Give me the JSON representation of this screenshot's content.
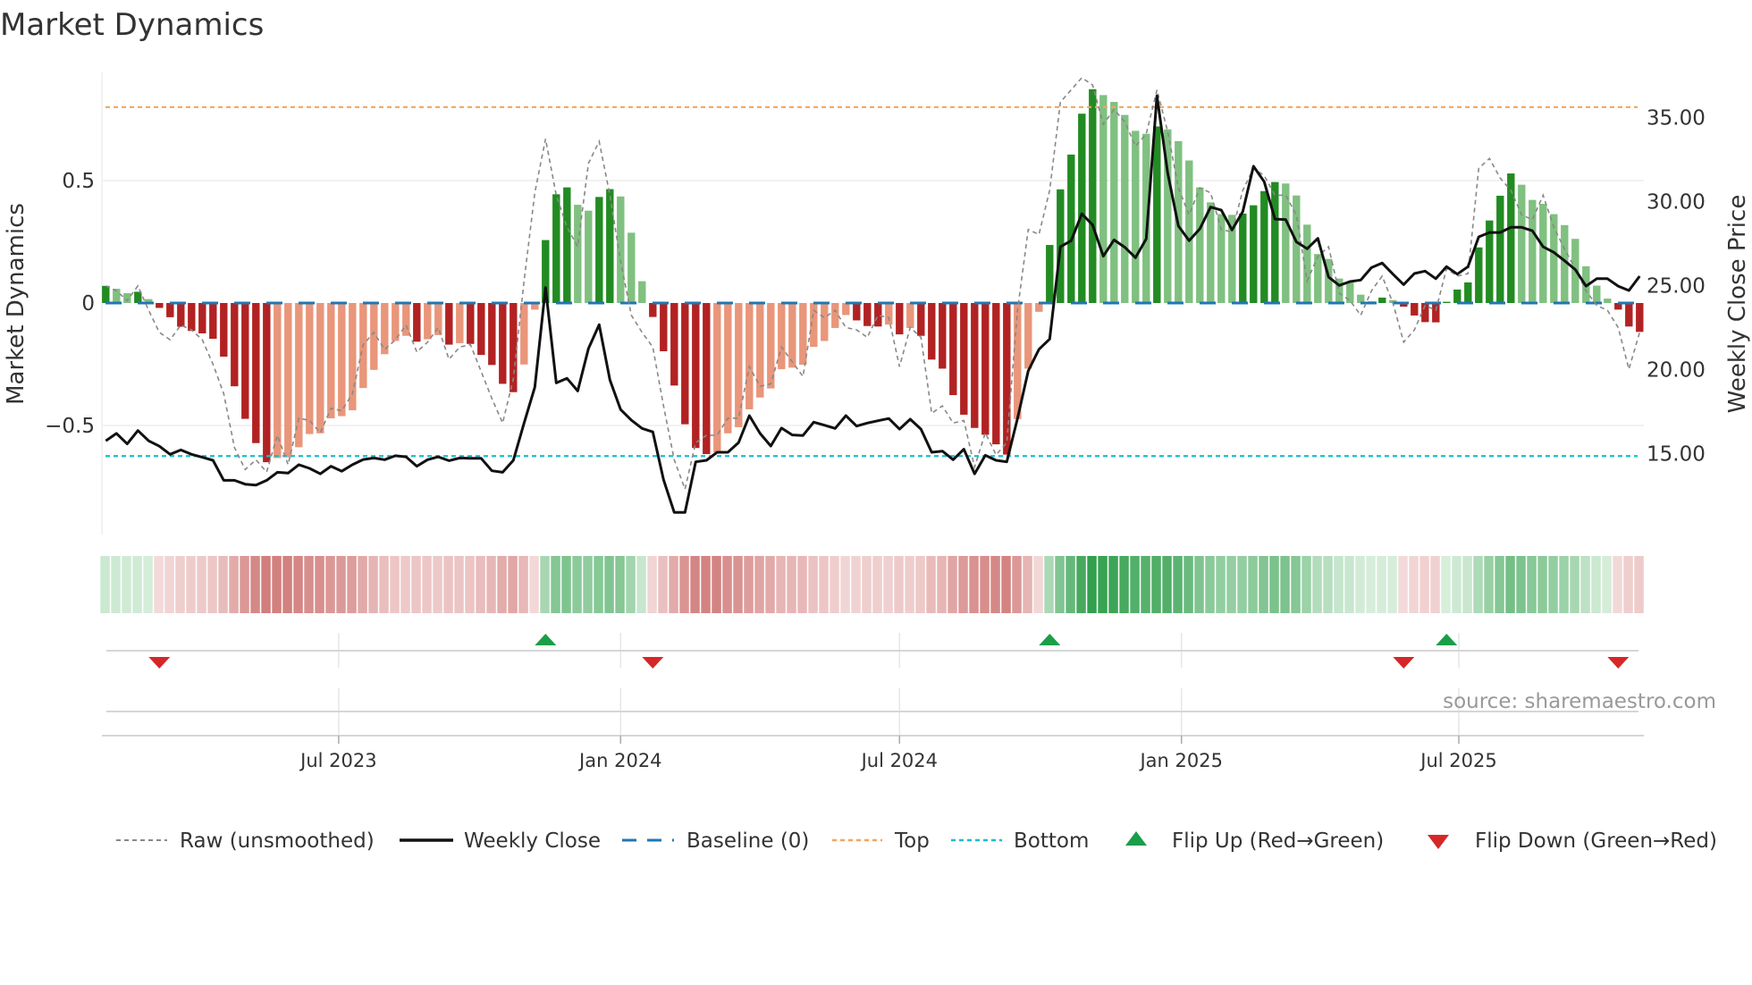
{
  "chart_data": {
    "type": "bar",
    "title": "Market Dynamics",
    "ylabel_left": "Market Dynamics",
    "ylabel_right": "Weekly Close Price",
    "source": "source: sharemaestro.com",
    "start_date": "2023-01-30",
    "frequency": "weekly",
    "ylim_left": [
      -0.95,
      0.98
    ],
    "ylim_right": [
      10.5,
      38.5
    ],
    "left_ticks": [
      {
        "value": 0.5,
        "label": "0.5"
      },
      {
        "value": 0,
        "label": "0"
      },
      {
        "value": -0.5,
        "label": "−0.5"
      }
    ],
    "right_ticks": [
      {
        "value": 35,
        "label": "35.00"
      },
      {
        "value": 30,
        "label": "30.00"
      },
      {
        "value": 25,
        "label": "25.00"
      },
      {
        "value": 20,
        "label": "20.00"
      },
      {
        "value": 15,
        "label": "15.00"
      }
    ],
    "x_ticks": [
      {
        "label": "Jul 2023",
        "date": "2023-07-01"
      },
      {
        "label": "Jan 2024",
        "date": "2024-01-01"
      },
      {
        "label": "Jul 2024",
        "date": "2024-07-01"
      },
      {
        "label": "Jan 2025",
        "date": "2025-01-01"
      },
      {
        "label": "Jul 2025",
        "date": "2025-07-01"
      }
    ],
    "reference_lines": {
      "top": 0.8,
      "bottom": -0.625,
      "baseline": 0
    },
    "series": [
      {
        "name": "Market Dynamics (smoothed)",
        "kind": "bar",
        "values": [
          0.07,
          0.058,
          0.04,
          0.046,
          0.016,
          -0.02,
          -0.058,
          -0.097,
          -0.114,
          -0.124,
          -0.146,
          -0.219,
          -0.34,
          -0.473,
          -0.572,
          -0.65,
          -0.633,
          -0.63,
          -0.589,
          -0.535,
          -0.532,
          -0.471,
          -0.462,
          -0.438,
          -0.347,
          -0.273,
          -0.209,
          -0.155,
          -0.134,
          -0.158,
          -0.148,
          -0.131,
          -0.17,
          -0.164,
          -0.167,
          -0.212,
          -0.253,
          -0.33,
          -0.364,
          -0.251,
          -0.027,
          0.257,
          0.444,
          0.472,
          0.401,
          0.377,
          0.433,
          0.465,
          0.435,
          0.287,
          0.089,
          -0.057,
          -0.197,
          -0.337,
          -0.495,
          -0.592,
          -0.617,
          -0.61,
          -0.532,
          -0.507,
          -0.434,
          -0.386,
          -0.349,
          -0.27,
          -0.264,
          -0.252,
          -0.179,
          -0.155,
          -0.102,
          -0.049,
          -0.071,
          -0.094,
          -0.096,
          -0.088,
          -0.128,
          -0.102,
          -0.134,
          -0.231,
          -0.268,
          -0.376,
          -0.456,
          -0.51,
          -0.538,
          -0.577,
          -0.619,
          -0.474,
          -0.268,
          -0.036,
          0.237,
          0.464,
          0.606,
          0.773,
          0.873,
          0.849,
          0.821,
          0.768,
          0.703,
          0.691,
          0.721,
          0.709,
          0.661,
          0.582,
          0.472,
          0.411,
          0.363,
          0.36,
          0.365,
          0.399,
          0.457,
          0.494,
          0.488,
          0.439,
          0.32,
          0.2,
          0.18,
          0.1,
          0.083,
          0.034,
          0.007,
          0.022,
          0.012,
          -0.015,
          -0.051,
          -0.078,
          -0.079,
          0.005,
          0.055,
          0.084,
          0.227,
          0.337,
          0.438,
          0.529,
          0.483,
          0.421,
          0.405,
          0.363,
          0.318,
          0.262,
          0.15,
          0.071,
          0.018,
          -0.027,
          -0.096,
          -0.118
        ]
      },
      {
        "name": "Raw (unsmoothed)",
        "kind": "line",
        "values": [
          0.07,
          0.05,
          0.01,
          0.07,
          -0.03,
          -0.12,
          -0.15,
          -0.09,
          -0.11,
          -0.15,
          -0.25,
          -0.37,
          -0.59,
          -0.68,
          -0.64,
          -0.69,
          -0.54,
          -0.66,
          -0.47,
          -0.48,
          -0.53,
          -0.43,
          -0.44,
          -0.37,
          -0.17,
          -0.12,
          -0.19,
          -0.15,
          -0.09,
          -0.2,
          -0.16,
          -0.1,
          -0.23,
          -0.18,
          -0.17,
          -0.28,
          -0.39,
          -0.49,
          -0.31,
          0.09,
          0.45,
          0.67,
          0.44,
          0.31,
          0.23,
          0.57,
          0.66,
          0.44,
          0.17,
          -0.05,
          -0.12,
          -0.18,
          -0.42,
          -0.64,
          -0.76,
          -0.57,
          -0.54,
          -0.54,
          -0.47,
          -0.47,
          -0.26,
          -0.34,
          -0.33,
          -0.18,
          -0.24,
          -0.3,
          -0.03,
          -0.06,
          -0.03,
          -0.1,
          -0.11,
          -0.14,
          -0.05,
          -0.06,
          -0.26,
          -0.1,
          -0.14,
          -0.45,
          -0.42,
          -0.49,
          -0.48,
          -0.67,
          -0.53,
          -0.62,
          -0.57,
          -0.03,
          0.3,
          0.28,
          0.46,
          0.82,
          0.87,
          0.92,
          0.89,
          0.73,
          0.79,
          0.74,
          0.64,
          0.69,
          0.87,
          0.7,
          0.47,
          0.36,
          0.47,
          0.45,
          0.3,
          0.29,
          0.46,
          0.55,
          0.52,
          0.44,
          0.44,
          0.36,
          0.09,
          0.19,
          0.23,
          0.04,
          0.01,
          -0.05,
          0.05,
          0.11,
          0.0,
          -0.16,
          -0.11,
          -0.01,
          -0.03,
          0.14,
          0.11,
          0.12,
          0.55,
          0.59,
          0.51,
          0.46,
          0.36,
          0.34,
          0.44,
          0.31,
          0.22,
          0.14,
          0.05,
          -0.01,
          -0.03,
          -0.1,
          -0.27,
          -0.12
        ]
      },
      {
        "name": "Weekly Close",
        "kind": "line",
        "axis": "right",
        "values": [
          15.76,
          16.2,
          15.58,
          16.37,
          15.76,
          15.44,
          14.96,
          15.22,
          14.96,
          14.78,
          14.6,
          13.41,
          13.41,
          13.18,
          13.13,
          13.41,
          13.89,
          13.84,
          14.34,
          14.12,
          13.8,
          14.25,
          13.95,
          14.34,
          14.65,
          14.74,
          14.64,
          14.87,
          14.81,
          14.25,
          14.64,
          14.81,
          14.58,
          14.74,
          14.72,
          14.72,
          13.98,
          13.89,
          14.6,
          16.82,
          18.95,
          24.88,
          19.21,
          19.48,
          18.73,
          21.25,
          22.67,
          19.39,
          17.62,
          16.99,
          16.5,
          16.29,
          13.45,
          11.5,
          11.5,
          14.51,
          14.6,
          15.08,
          15.08,
          15.66,
          17.26,
          16.2,
          15.45,
          16.52,
          16.11,
          16.08,
          16.87,
          16.69,
          16.5,
          17.26,
          16.64,
          16.82,
          16.96,
          17.09,
          16.46,
          17.05,
          16.46,
          15.08,
          15.15,
          14.64,
          15.26,
          13.8,
          14.9,
          14.6,
          14.51,
          17.09,
          19.92,
          21.21,
          21.82,
          27.31,
          27.67,
          29.27,
          28.61,
          26.75,
          27.72,
          27.28,
          26.66,
          27.78,
          36.29,
          31.71,
          28.55,
          27.67,
          28.38,
          29.67,
          29.49,
          28.31,
          29.4,
          32.1,
          31.18,
          28.96,
          28.93,
          27.6,
          27.19,
          27.81,
          25.51,
          25.01,
          25.24,
          25.33,
          26.07,
          26.34,
          25.68,
          25.06,
          25.72,
          25.86,
          25.41,
          26.13,
          25.68,
          26.13,
          27.9,
          28.16,
          28.16,
          28.47,
          28.47,
          28.26,
          27.31,
          26.98,
          26.48,
          25.95,
          24.97,
          25.41,
          25.41,
          24.97,
          24.71,
          25.56
        ]
      }
    ],
    "legend": {
      "placement": "bottom",
      "items": [
        {
          "key": "raw",
          "label": "Raw (unsmoothed)"
        },
        {
          "key": "close",
          "label": "Weekly Close"
        },
        {
          "key": "baseline",
          "label": "Baseline (0)"
        },
        {
          "key": "top",
          "label": "Top"
        },
        {
          "key": "bottom",
          "label": "Bottom"
        },
        {
          "key": "flip_up",
          "label": "Flip Up (Red→Green)"
        },
        {
          "key": "flip_down",
          "label": "Flip Down (Green→Red)"
        }
      ]
    },
    "colors": {
      "pos_strong": "#228b22",
      "pos_weak": "#80c080",
      "neg_strong": "#b22222",
      "neg_weak": "#e9967a",
      "close": "#111111",
      "raw": "#888888",
      "baseline": "#1f77b4",
      "top": "#f4a460",
      "bottom": "#17becf",
      "flip_up": "#1a9e48",
      "flip_down": "#d62728",
      "heat_pos_dark": "#2e9e4a",
      "heat_pos_light": "#d8eedc",
      "heat_neg_dark": "#c45a57",
      "heat_neg_light": "#f4dcdc"
    }
  }
}
